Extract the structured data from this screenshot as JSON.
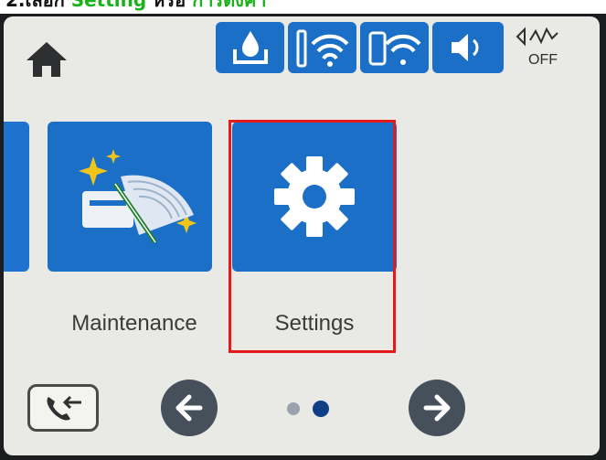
{
  "caption": {
    "prefix": "2.เลือก ",
    "highlight1": "Setting",
    "middle": " หรือ ",
    "highlight2": "การตั้งค่า"
  },
  "statusbar": {
    "icons": [
      "ink-level-icon",
      "wifi-icon",
      "wifi-direct-icon",
      "sound-icon",
      "eco-off-icon"
    ]
  },
  "tiles": {
    "maintenance_label": "Maintenance",
    "settings_label": "Settings"
  },
  "pagination": {
    "total_pages": 2,
    "current_page": 2
  },
  "colors": {
    "accent": "#1c6fc6",
    "highlight_box": "#e41a1a",
    "caption_green": "#19b319"
  }
}
